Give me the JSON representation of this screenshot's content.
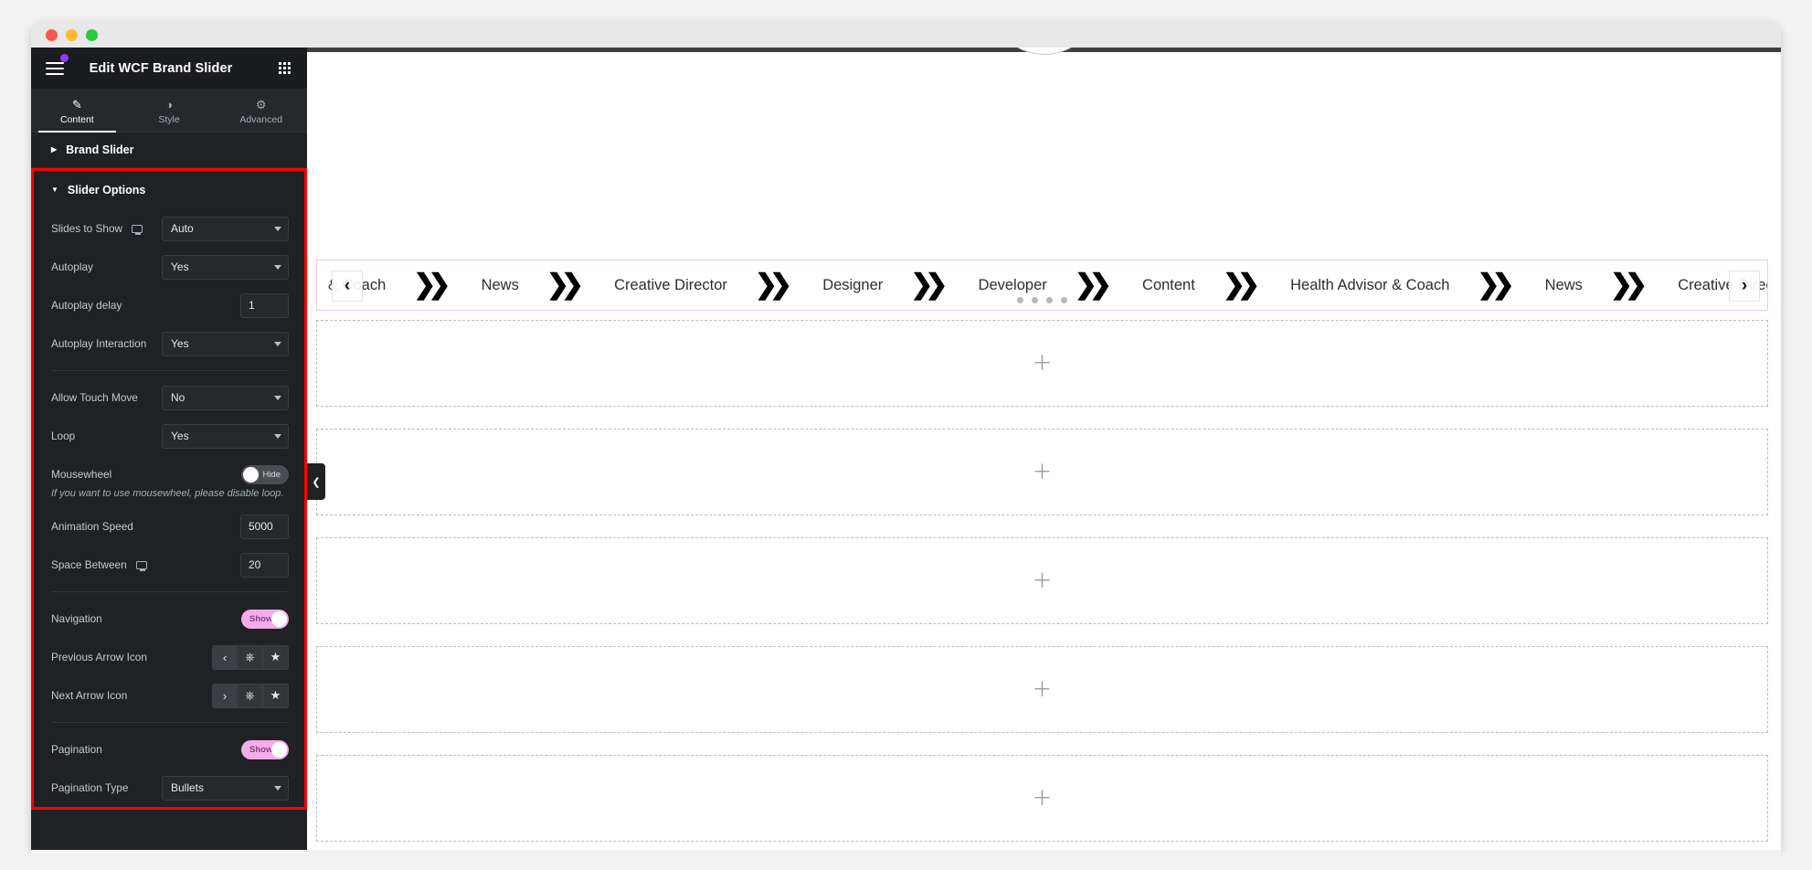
{
  "window": {
    "traffic_lights": [
      "close",
      "minimize",
      "maximize"
    ]
  },
  "panel": {
    "title": "Edit WCF Brand Slider",
    "menu_icon": "hamburger-icon",
    "grid_icon": "apps-grid-icon",
    "tabs": [
      {
        "label": "Content",
        "icon": "pencil-icon",
        "active": true
      },
      {
        "label": "Style",
        "icon": "half-circle-icon",
        "active": false
      },
      {
        "label": "Advanced",
        "icon": "gear-icon",
        "active": false
      }
    ],
    "sections": [
      {
        "label": "Brand Slider",
        "expanded": false
      },
      {
        "label": "Slider Options",
        "expanded": true
      }
    ],
    "controls": {
      "slides_to_show": {
        "label": "Slides to Show",
        "value": "Auto",
        "device_icon": "desktop-icon"
      },
      "autoplay": {
        "label": "Autoplay",
        "value": "Yes"
      },
      "autoplay_delay": {
        "label": "Autoplay delay",
        "value": "1"
      },
      "autoplay_interaction": {
        "label": "Autoplay Interaction",
        "value": "Yes"
      },
      "allow_touch_move": {
        "label": "Allow Touch Move",
        "value": "No"
      },
      "loop": {
        "label": "Loop",
        "value": "Yes"
      },
      "mousewheel": {
        "label": "Mousewheel",
        "state": "Hide",
        "on": false
      },
      "mousewheel_help": "If you want to use mousewheel, please disable loop.",
      "animation_speed": {
        "label": "Animation Speed",
        "value": "5000"
      },
      "space_between": {
        "label": "Space Between",
        "value": "20",
        "device_icon": "desktop-icon"
      },
      "navigation": {
        "label": "Navigation",
        "state": "Show",
        "on": true
      },
      "previous_arrow_icon": {
        "label": "Previous Arrow Icon",
        "buttons": [
          "chevron-left-icon",
          "upload-icon",
          "star-icon"
        ]
      },
      "next_arrow_icon": {
        "label": "Next Arrow Icon",
        "buttons": [
          "chevron-right-icon",
          "upload-icon",
          "star-icon"
        ]
      },
      "pagination": {
        "label": "Pagination",
        "state": "Show",
        "on": true
      },
      "pagination_type": {
        "label": "Pagination Type",
        "value": "Bullets"
      }
    }
  },
  "colors": {
    "panel_bg": "#1f2124",
    "highlight_border": "#ff0000",
    "toggle_on": "#f3aeea",
    "accent_purple": "#8b3ff5",
    "widget_outline": "#f0c8ee"
  },
  "canvas": {
    "collapse_handle_icon": "chevron-left-icon",
    "slider": {
      "separator_glyph": "double-chevron-right-icon",
      "items": [
        "& Coach",
        "News",
        "Creative Director",
        "Designer",
        "Developer",
        "Content",
        "Health Advisor & Coach",
        "News",
        "Creative Director"
      ],
      "prev_arrow": "‹",
      "next_arrow": "›",
      "pagination_bullets": 4
    },
    "empty_sections": [
      {
        "add_label": "+"
      },
      {
        "add_label": "+"
      },
      {
        "add_label": "+"
      },
      {
        "add_label": "+"
      },
      {
        "add_label": "+"
      }
    ]
  }
}
